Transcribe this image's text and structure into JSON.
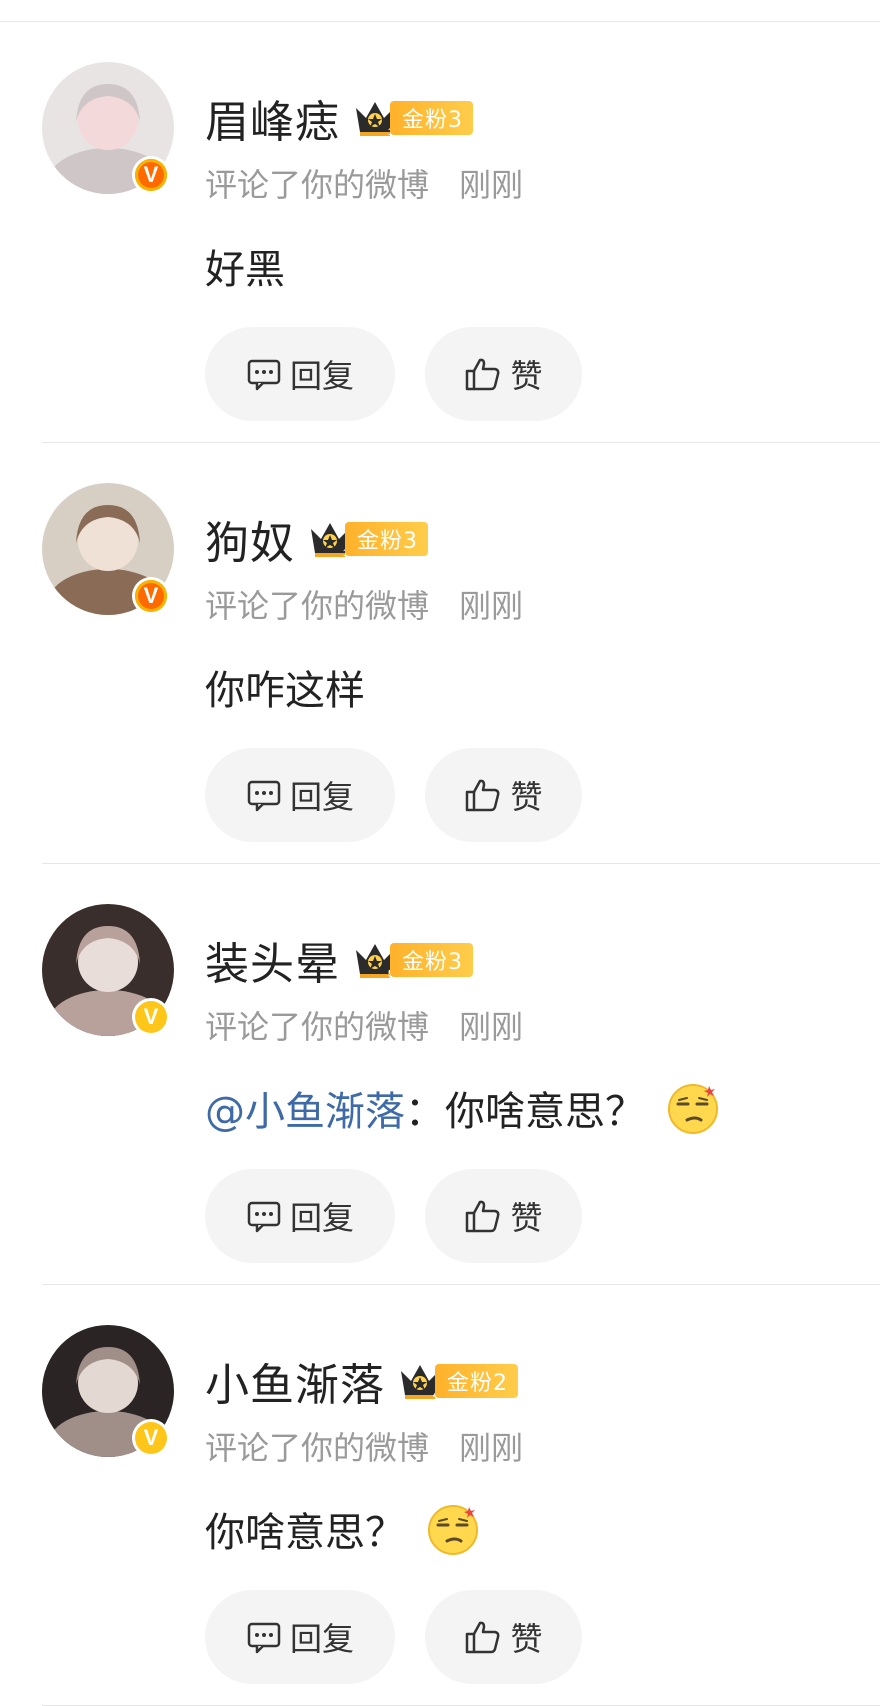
{
  "items": [
    {
      "name": "眉峰痣",
      "fan_label": "金粉3",
      "crown_num": "1",
      "action": "评论了你的微博",
      "time": "刚刚",
      "mention": "",
      "sep": "",
      "text": "好黑",
      "emoji": false,
      "verified_color": "red",
      "reply_label": "回复",
      "like_label": "赞"
    },
    {
      "name": "狗奴",
      "fan_label": "金粉3",
      "crown_num": "1",
      "action": "评论了你的微博",
      "time": "刚刚",
      "mention": "",
      "sep": "",
      "text": "你咋这样",
      "emoji": false,
      "verified_color": "red",
      "reply_label": "回复",
      "like_label": "赞"
    },
    {
      "name": "装头晕",
      "fan_label": "金粉3",
      "crown_num": "5",
      "action": "评论了你的微博",
      "time": "刚刚",
      "mention": "@小鱼渐落",
      "sep": "：",
      "text": "你啥意思？",
      "emoji": true,
      "verified_color": "gold",
      "reply_label": "回复",
      "like_label": "赞"
    },
    {
      "name": "小鱼渐落",
      "fan_label": "金粉2",
      "crown_num": "4",
      "action": "评论了你的微博",
      "time": "刚刚",
      "mention": "",
      "sep": "",
      "text": "你啥意思？",
      "emoji": true,
      "verified_color": "gold",
      "reply_label": "回复",
      "like_label": "赞"
    }
  ],
  "icons": {
    "verified": "V",
    "reply": "comment-icon",
    "like": "thumbs-up-icon",
    "emoji": "smirk-emoji-icon",
    "crown": "crown-icon"
  },
  "colors": {
    "mention": "#3e6aa8",
    "fan_badge": "#ffb12b",
    "verified_red": "#ff6a00",
    "verified_gold": "#ffc61a"
  }
}
